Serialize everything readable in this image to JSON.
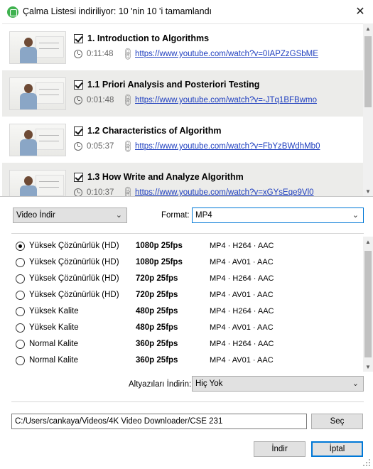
{
  "window": {
    "title": "Çalma Listesi indiriliyor: 10 'nin 10 'i tamamlandı",
    "close_glyph": "✕",
    "icon": "app-icon"
  },
  "playlist": {
    "items": [
      {
        "title": "1. Introduction to Algorithms",
        "duration": "0:11:48",
        "url": "https://www.youtube.com/watch?v=0IAPZzGSbME",
        "checked": true
      },
      {
        "title": "1.1 Priori Analysis and Posteriori Testing",
        "duration": "0:01:48",
        "url": "https://www.youtube.com/watch?v=-JTq1BFBwmo",
        "checked": true
      },
      {
        "title": "1.2 Characteristics of Algorithm",
        "duration": "0:05:37",
        "url": "https://www.youtube.com/watch?v=FbYzBWdhMb0",
        "checked": true
      },
      {
        "title": "1.3 How Write and Analyze Algorithm",
        "duration": "0:10:37",
        "url": "https://www.youtube.com/watch?v=xGYsEqe9Vl0",
        "checked": true
      }
    ]
  },
  "download_type": {
    "value": "Video İndir"
  },
  "format": {
    "label": "Format:",
    "value": "MP4"
  },
  "qualities": [
    {
      "name": "Yüksek Çözünürlük (HD)",
      "resolution": "1080p 25fps",
      "codec": "MP4 · H264 · AAC",
      "selected": true
    },
    {
      "name": "Yüksek Çözünürlük (HD)",
      "resolution": "1080p 25fps",
      "codec": "MP4 · AV01 · AAC",
      "selected": false
    },
    {
      "name": "Yüksek Çözünürlük (HD)",
      "resolution": "720p 25fps",
      "codec": "MP4 · H264 · AAC",
      "selected": false
    },
    {
      "name": "Yüksek Çözünürlük (HD)",
      "resolution": "720p 25fps",
      "codec": "MP4 · AV01 · AAC",
      "selected": false
    },
    {
      "name": "Yüksek Kalite",
      "resolution": "480p 25fps",
      "codec": "MP4 · H264 · AAC",
      "selected": false
    },
    {
      "name": "Yüksek Kalite",
      "resolution": "480p 25fps",
      "codec": "MP4 · AV01 · AAC",
      "selected": false
    },
    {
      "name": "Normal Kalite",
      "resolution": "360p 25fps",
      "codec": "MP4 · H264 · AAC",
      "selected": false
    },
    {
      "name": "Normal Kalite",
      "resolution": "360p 25fps",
      "codec": "MP4 · AV01 · AAC",
      "selected": false
    }
  ],
  "subtitles": {
    "label": "Altyazıları İndirin:",
    "value": "Hiç Yok"
  },
  "path": {
    "value": "C:/Users/cankaya/Videos/4K Video Downloader/CSE 231"
  },
  "buttons": {
    "choose": "Seç",
    "download": "İndir",
    "cancel": "İptal"
  },
  "colors": {
    "link": "#1f3fbf",
    "accent": "#0078d7",
    "app_icon": "#3fb24f"
  }
}
